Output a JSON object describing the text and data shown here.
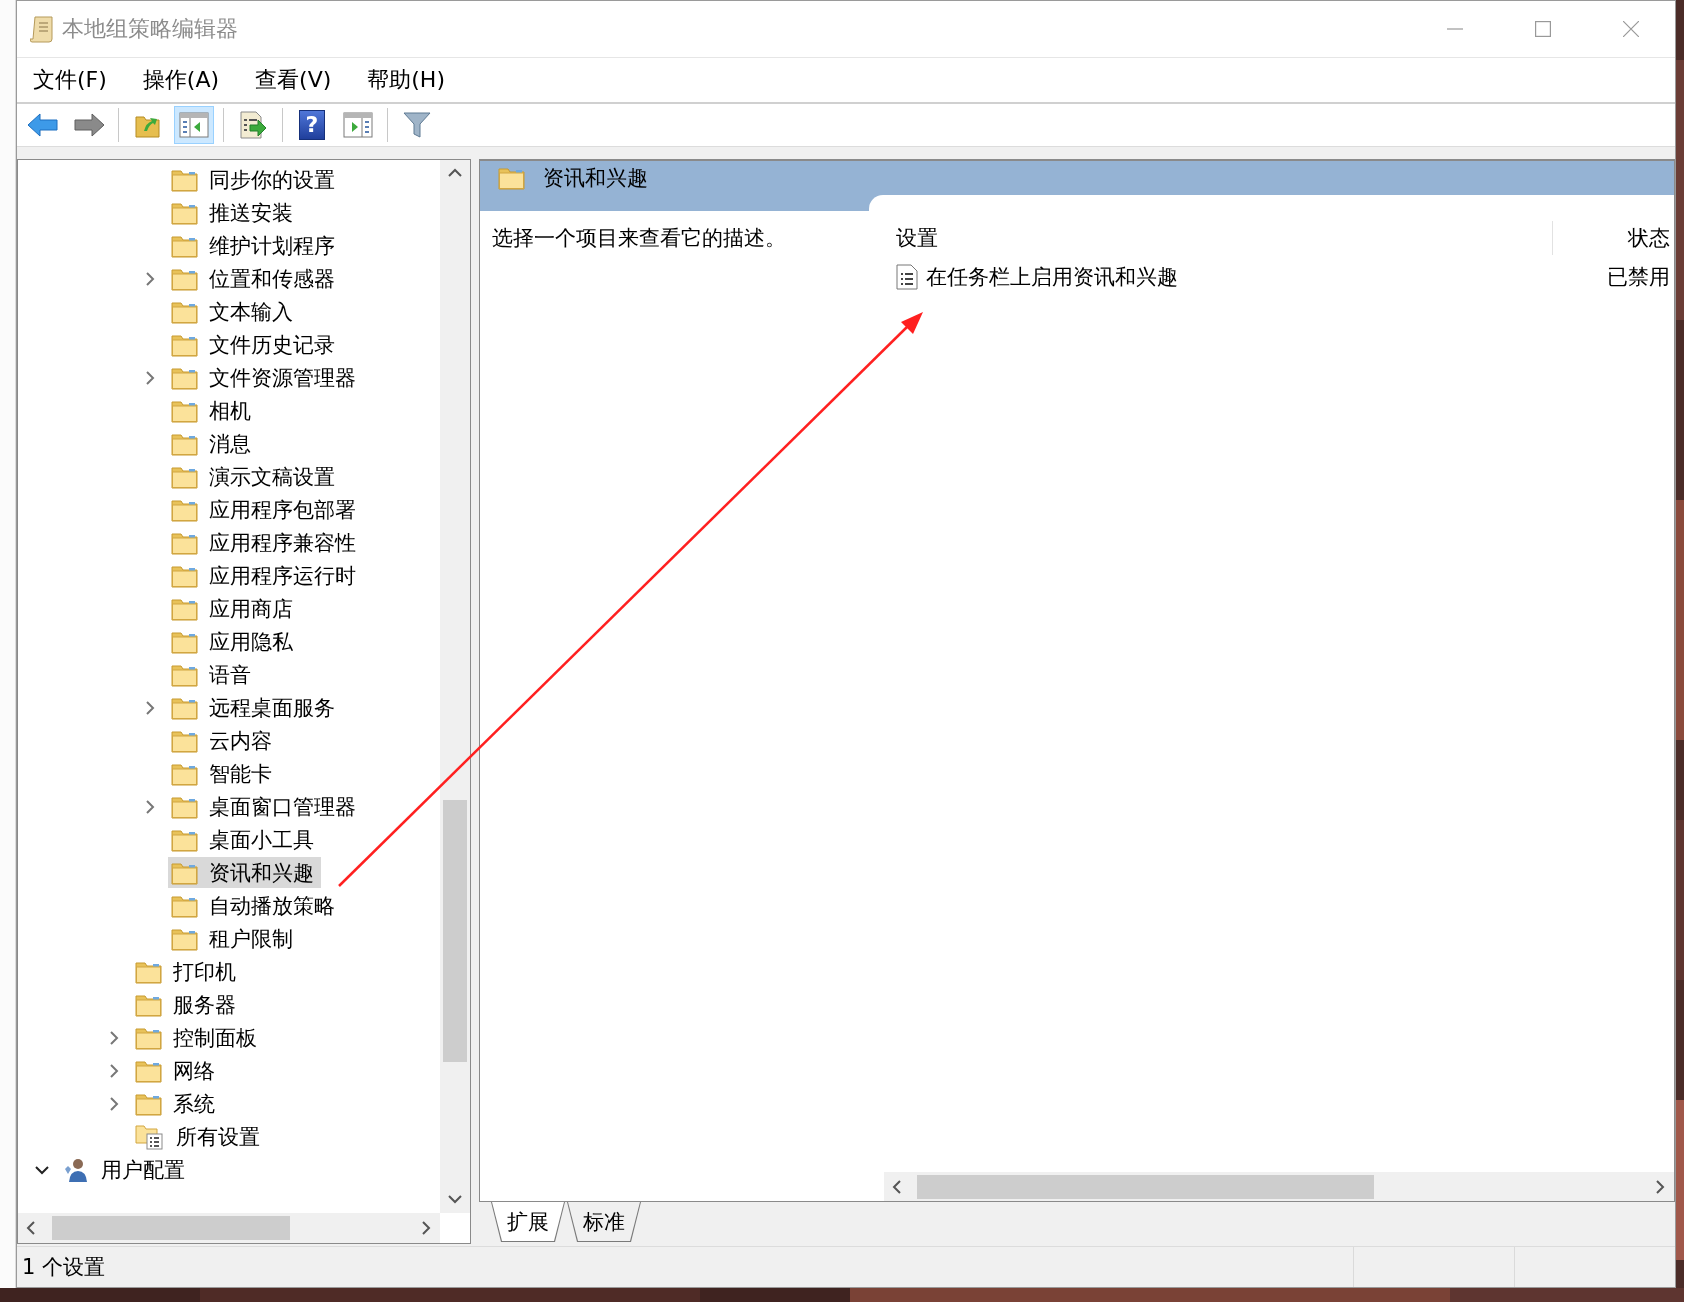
{
  "window": {
    "title": "本地组策略编辑器",
    "controls": [
      {
        "kind": "minimize"
      },
      {
        "kind": "maximize"
      },
      {
        "kind": "close"
      }
    ]
  },
  "menu": [
    "文件(F)",
    "操作(A)",
    "查看(V)",
    "帮助(H)"
  ],
  "toolbar": [
    {
      "kind": "back",
      "pressed": false
    },
    {
      "kind": "forward",
      "pressed": false
    },
    {
      "kind": "separator"
    },
    {
      "kind": "up",
      "pressed": false
    },
    {
      "kind": "tree-toggle",
      "pressed": true
    },
    {
      "kind": "separator"
    },
    {
      "kind": "export",
      "pressed": false
    },
    {
      "kind": "separator"
    },
    {
      "kind": "help",
      "pressed": false,
      "glyph": "?"
    },
    {
      "kind": "action-pane",
      "pressed": false
    },
    {
      "kind": "separator"
    },
    {
      "kind": "filter",
      "pressed": false
    }
  ],
  "tree": {
    "continued_children": [
      {
        "label": "同步你的设置",
        "kind": "folder",
        "selected": false
      },
      {
        "label": "推送安装",
        "kind": "folder",
        "selected": false
      },
      {
        "label": "维护计划程序",
        "kind": "folder",
        "selected": false
      },
      {
        "label": "位置和传感器",
        "kind": "folder",
        "expanded": false,
        "selected": false
      },
      {
        "label": "文本输入",
        "kind": "folder",
        "selected": false
      },
      {
        "label": "文件历史记录",
        "kind": "folder",
        "selected": false
      },
      {
        "label": "文件资源管理器",
        "kind": "folder",
        "expanded": false,
        "selected": false
      },
      {
        "label": "相机",
        "kind": "folder",
        "selected": false
      },
      {
        "label": "消息",
        "kind": "folder",
        "selected": false
      },
      {
        "label": "演示文稿设置",
        "kind": "folder",
        "selected": false
      },
      {
        "label": "应用程序包部署",
        "kind": "folder",
        "selected": false
      },
      {
        "label": "应用程序兼容性",
        "kind": "folder",
        "selected": false
      },
      {
        "label": "应用程序运行时",
        "kind": "folder",
        "selected": false
      },
      {
        "label": "应用商店",
        "kind": "folder",
        "selected": false
      },
      {
        "label": "应用隐私",
        "kind": "folder",
        "selected": false
      },
      {
        "label": "语音",
        "kind": "folder",
        "selected": false
      },
      {
        "label": "远程桌面服务",
        "kind": "folder",
        "expanded": false,
        "selected": false
      },
      {
        "label": "云内容",
        "kind": "folder",
        "selected": false
      },
      {
        "label": "智能卡",
        "kind": "folder",
        "selected": false
      },
      {
        "label": "桌面窗口管理器",
        "kind": "folder",
        "expanded": false,
        "selected": false
      },
      {
        "label": "桌面小工具",
        "kind": "folder",
        "selected": false
      },
      {
        "label": "资讯和兴趣",
        "kind": "folder",
        "selected": true
      },
      {
        "label": "自动播放策略",
        "kind": "folder",
        "selected": false
      },
      {
        "label": "租户限制",
        "kind": "folder",
        "selected": false
      }
    ],
    "items": [
      {
        "label": "打印机",
        "kind": "folder",
        "selected": false
      },
      {
        "label": "服务器",
        "kind": "folder",
        "selected": false
      },
      {
        "label": "控制面板",
        "kind": "folder",
        "expanded": false,
        "selected": false
      },
      {
        "label": "网络",
        "kind": "folder",
        "expanded": false,
        "selected": false
      },
      {
        "label": "系统",
        "kind": "folder",
        "expanded": false,
        "selected": false
      },
      {
        "label": "所有设置",
        "kind": "settings",
        "selected": false
      }
    ],
    "root_items": [
      {
        "label": "用户配置",
        "kind": "user",
        "expanded": true,
        "selected": false
      }
    ]
  },
  "details": {
    "header": {
      "title": "资讯和兴趣"
    },
    "description": "选择一个项目来查看它的描述。",
    "columns": [
      "设置",
      "状态"
    ],
    "rows": [
      {
        "setting": "在任务栏上启用资讯和兴趣",
        "state": "已禁用"
      }
    ]
  },
  "view_tabs": [
    {
      "label": "扩展",
      "selected": true
    },
    {
      "label": "标准",
      "selected": false
    }
  ],
  "status_bar": {
    "text": "1 个设置"
  }
}
